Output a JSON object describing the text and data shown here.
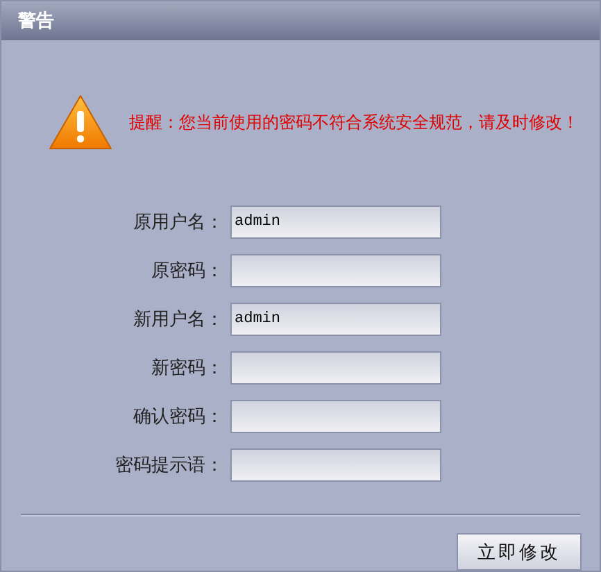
{
  "window": {
    "title": "警告"
  },
  "message": "提醒：您当前使用的密码不符合系统安全规范，请及时修改！",
  "fields": [
    {
      "label": "原用户名：",
      "value": "admin"
    },
    {
      "label": "原密码："
    },
    {
      "label": "新用户名：",
      "value": "admin"
    },
    {
      "label": "新密码："
    },
    {
      "label": "确认密码："
    },
    {
      "label": "密码提示语："
    }
  ],
  "buttons": [
    "立即修改"
  ]
}
